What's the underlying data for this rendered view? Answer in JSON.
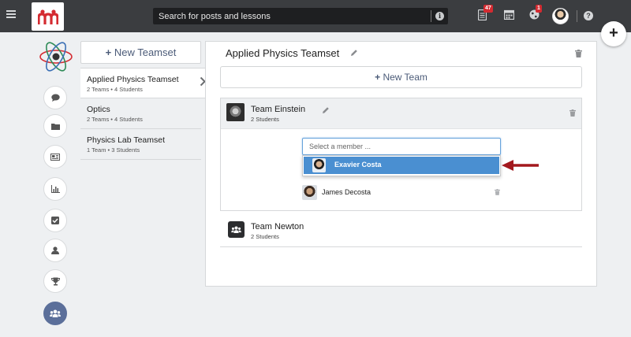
{
  "topbar": {
    "search": {
      "placeholder": "Search for posts and lessons"
    },
    "notifications_badge": "47",
    "globe_badge": "1"
  },
  "teamsets": {
    "new_label": "New Teamset",
    "items": [
      {
        "name": "Applied Physics Teamset",
        "meta": "2 Teams • 4 Students"
      },
      {
        "name": "Optics",
        "meta": "2 Teams • 4 Students"
      },
      {
        "name": "Physics Lab Teamset",
        "meta": "1 Team • 3 Students"
      }
    ]
  },
  "panel": {
    "title": "Applied Physics Teamset",
    "new_team_label": "New Team",
    "team1": {
      "name": "Team Einstein",
      "meta": "2 Students",
      "select_placeholder": "Select a member ...",
      "dropdown_option": "Exavier Costa",
      "member": "James Decosta"
    },
    "team2": {
      "name": "Team Newton",
      "meta": "2 Students"
    }
  },
  "colors": {
    "topbar": "#3b3d40",
    "accent": "#4a8fd1",
    "brand_red": "#d42b31",
    "annotation_arrow": "#a3181d"
  }
}
